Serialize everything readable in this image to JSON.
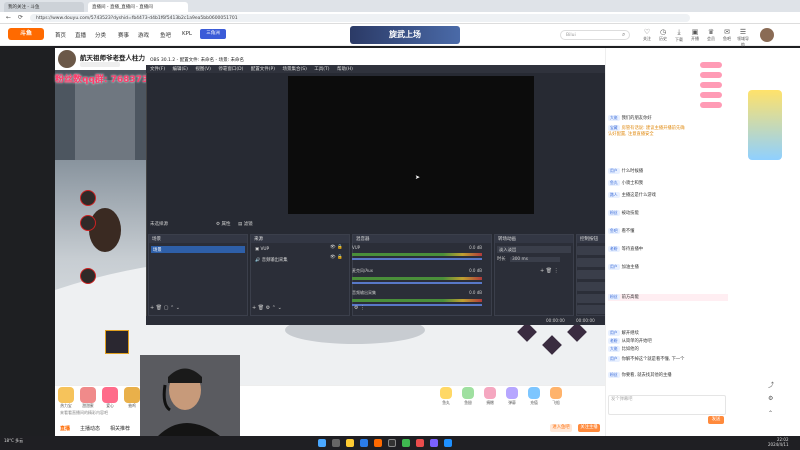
{
  "browser": {
    "tabs": [
      "我的关注 - 斗鱼",
      "直播间 - 直播_直播间 - 直播间"
    ],
    "url": "https://www.douyu.com/5743523?dyshid=fb4473-d4b1f6f5413b2c1a9ea5bb0600051701"
  },
  "site": {
    "logo": "斗鱼",
    "nav": [
      "首页",
      "直播",
      "分类",
      "赛事",
      "游戏",
      "鱼吧",
      "KPL"
    ],
    "badge": "三角洲",
    "banner": "旋武上场",
    "search_placeholder": "Bilui",
    "top_icons": [
      "关注",
      "历史",
      "下载",
      "开播",
      "会员",
      "鱼吧",
      "领域导航",
      "信"
    ]
  },
  "streamer": {
    "name": "航天祖师爷老登人柱力",
    "overlay_text": "粉丝数qq群: 768373..."
  },
  "room_tabs": [
    "贡献榜",
    "2020粉",
    "贵宾(0)",
    "钻粉榜"
  ],
  "obs": {
    "title": "OBS 30.1.2 - 配置文件: 未命名 - 场景: 未命名",
    "menu": [
      "文件(F)",
      "编辑(E)",
      "视图(V)",
      "停靠窗口(D)",
      "配置文件(P)",
      "场景集合(S)",
      "工具(T)",
      "帮助(H)"
    ],
    "scene_label": "未选择源",
    "properties": "属性",
    "filters": "滤镜",
    "docks": {
      "scenes": {
        "title": "场景",
        "items": [
          "场景"
        ]
      },
      "sources": {
        "title": "来源",
        "items": [
          "VUP",
          "音频输出采集"
        ]
      },
      "mixer": {
        "title": "混音器",
        "tracks": [
          {
            "name": "VUP",
            "db": "0.0 dB"
          },
          {
            "name": "麦克风/Aux",
            "db": "0.0 dB"
          },
          {
            "name": "音频输出采集",
            "db": "0.0 dB"
          }
        ]
      },
      "transitions": {
        "title": "转场动画",
        "mode": "淡入淡出",
        "duration_label": "时长",
        "duration": "300 ms"
      },
      "controls": {
        "title": "控制按钮",
        "buttons": [
          "开始直播",
          "开始录制",
          "启动虚拟摄像机",
          "工作室模式",
          "设置",
          "退出"
        ]
      }
    },
    "status": {
      "cpu": "CPU: 0.6%",
      "fps": "30.00 / 30.00 FPS",
      "time1": "00:00:00",
      "time2": "00:00:00"
    }
  },
  "gifts": {
    "items": [
      "热力宝",
      "甜甜蜜",
      "爱心",
      "抽鸡",
      "宝藏",
      "粉丝团",
      "太空之旅",
      "超级火箭"
    ],
    "right_items": [
      "鱼丸",
      "鱼翅",
      "捐赠",
      "弹幕",
      "充值",
      "飞船"
    ],
    "note": "来看看直播间的精彩内容吧"
  },
  "under_tabs": [
    "直播",
    "主播动态",
    "相关推荐"
  ],
  "under_buttons": [
    "进入鱼吧",
    "关注主播"
  ],
  "chat": {
    "lines": [
      {
        "user": "大佬",
        "text": "我们的朋友你好"
      },
      {
        "user": "宝藏",
        "text": "房管有话说: 建议主播开播前先确认好配置, 注意直播安全"
      },
      {
        "user": "用户",
        "text": "什么时候播"
      },
      {
        "user": "鱼丸",
        "text": "小骑士和我"
      },
      {
        "user": "路人",
        "text": "主播这是什么游戏"
      },
      {
        "user": "粉丝",
        "text": "被动技能"
      },
      {
        "user": "鱼吧",
        "text": "看不懂"
      },
      {
        "user": "老粉",
        "text": "等待直播中"
      },
      {
        "user": "用户",
        "text": "加油主播"
      },
      {
        "user": "粉丝",
        "text": "前方高能"
      },
      {
        "user": "用户",
        "text": "解开继续"
      },
      {
        "user": "老粉",
        "text": "从简单的开始吧"
      },
      {
        "user": "大佬",
        "text": "比如他的"
      },
      {
        "user": "用户",
        "text": "你解不掉这个就是看不懂, 下一个"
      },
      {
        "user": "粉丝",
        "text": "你要看, 就去找其他的主播"
      }
    ],
    "input_placeholder": "发个弹幕吧",
    "send": "发送"
  },
  "taskbar": {
    "weather": "18°C 多云",
    "time": "22:02",
    "date": "2024/4/11"
  }
}
